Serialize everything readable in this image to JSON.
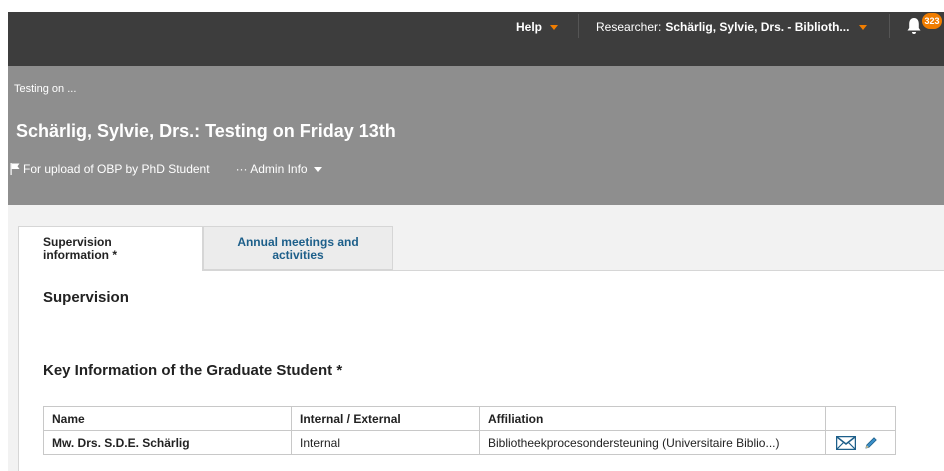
{
  "topbar": {
    "help_label": "Help",
    "researcher_prefix": "Researcher:",
    "researcher_name": "Schärlig, Sylvie, Drs. - Biblioth...",
    "notification_count": "323",
    "accent_color": "#f07d00"
  },
  "header": {
    "breadcrumb": "Testing on ...",
    "title": "Schärlig, Sylvie, Drs.: Testing on Friday 13th",
    "flag_label": "For upload of OBP by PhD Student",
    "admin_info_label": "··· Admin Info"
  },
  "tabs": [
    {
      "label_line1": "Supervision",
      "label_line2": "information *"
    },
    {
      "label_line1": "Annual meetings and",
      "label_line2": "activities"
    }
  ],
  "main": {
    "section_title": "Supervision",
    "key_info_title": "Key Information of the Graduate Student *",
    "table": {
      "headers": [
        "Name",
        "Internal / External",
        "Affiliation",
        ""
      ],
      "rows": [
        [
          "Mw. Drs. S.D.E. Schärlig",
          "Internal",
          "Bibliotheekprocesondersteuning (Universitaire Biblio...)"
        ]
      ]
    }
  }
}
